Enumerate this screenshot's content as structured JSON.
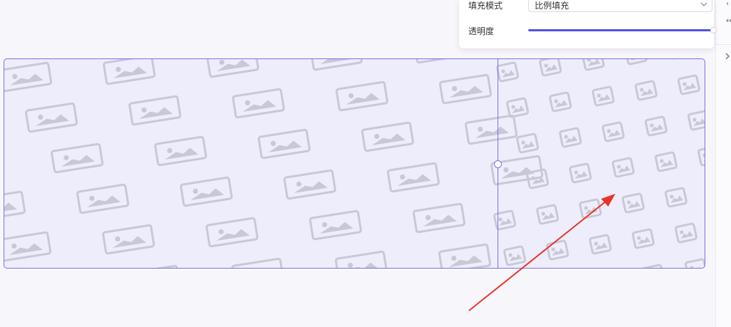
{
  "settings": {
    "fill_mode_label": "填充模式",
    "fill_mode_value": "比例填充",
    "opacity_label": "透明度",
    "opacity": 1.0
  },
  "colors": {
    "accent": "#5050e0",
    "frame_border": "#7b70f0",
    "pattern_bg": "#eeedfc",
    "annotation_arrow": "#e8352a"
  },
  "icons": {
    "pattern_tile": "image-placeholder-icon",
    "select_arrow": "chevron-down-icon",
    "strip_toggle": "chevron-right-icon"
  }
}
